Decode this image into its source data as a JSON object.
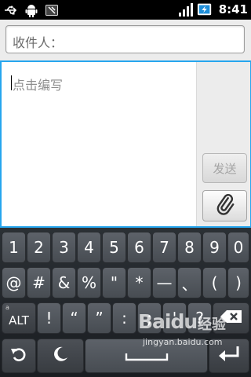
{
  "status_bar": {
    "time": "8:41",
    "icons": [
      "usb-icon",
      "android-debug-icon",
      "notification-icon",
      "signal-icon",
      "battery-charging-icon"
    ]
  },
  "compose": {
    "recipient_placeholder": "收件人：",
    "message_placeholder": "点击编写",
    "send_label": "发送",
    "attach_icon": "paperclip-icon"
  },
  "keyboard": {
    "row1": [
      "1",
      "2",
      "3",
      "4",
      "5",
      "6",
      "7",
      "8",
      "9",
      "0"
    ],
    "row2": [
      "@",
      "#",
      "&",
      "%",
      "\"",
      "*",
      "—",
      "、",
      "(",
      ")"
    ],
    "row3": {
      "alt_label": "ALT",
      "alt_sub": "a",
      "keys": [
        "!",
        "“",
        "”",
        ":",
        ";",
        "'",
        "?"
      ],
      "delete_icon": "backspace-icon"
    },
    "row4": {
      "undo_icon": "undo-icon",
      "emoji_icon": "moon-emoji-icon",
      "space_icon": "space-icon",
      "enter_icon": "enter-icon"
    }
  },
  "watermark": {
    "brand": "Baidu",
    "cn": "经验",
    "url": "jingyan.baidu.com"
  },
  "colors": {
    "focus_border": "#26a6ee",
    "key_bg": "#52575d",
    "keyboard_bg": "#23272b"
  }
}
